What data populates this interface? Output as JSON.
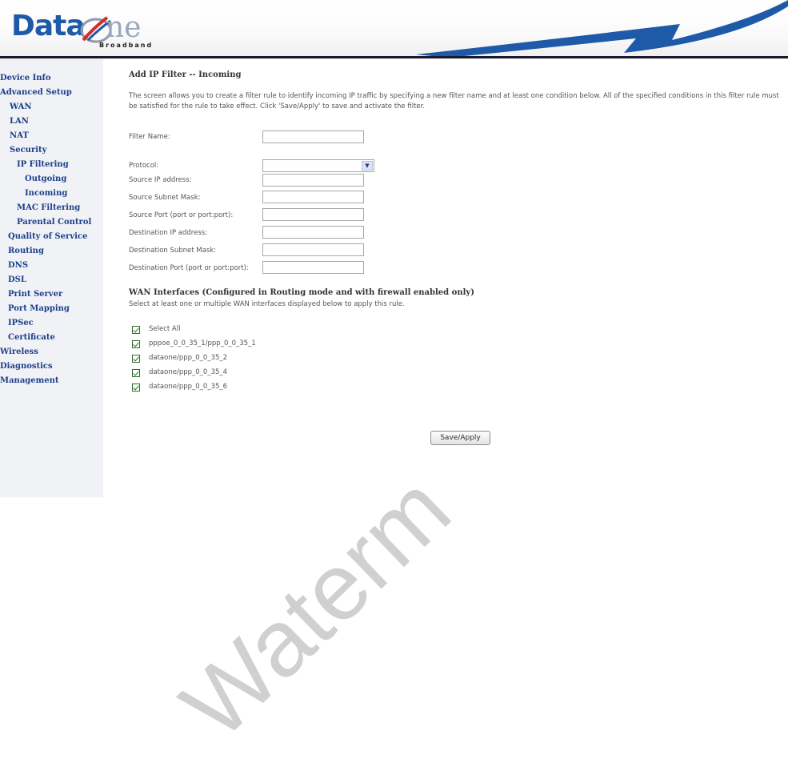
{
  "logo": {
    "brand_first": "Data",
    "brand_second": "ne",
    "tagline": "Broadband"
  },
  "nav": {
    "device_info": "Device Info",
    "advanced_setup": "Advanced Setup",
    "wan": "WAN",
    "lan": "LAN",
    "nat": "NAT",
    "security": "Security",
    "ip_filtering": "IP Filtering",
    "outgoing": "Outgoing",
    "incoming": "Incoming",
    "mac_filtering": "MAC Filtering",
    "parental_control": "Parental Control",
    "qos": "Quality of Service",
    "routing": "Routing",
    "dns": "DNS",
    "dsl": "DSL",
    "print_server": "Print Server",
    "port_mapping": "Port Mapping",
    "ipsec": "IPSec",
    "certificate": "Certificate",
    "wireless": "Wireless",
    "diagnostics": "Diagnostics",
    "management": "Management"
  },
  "page": {
    "title": "Add IP Filter -- Incoming",
    "description": "The screen allows you to create a filter rule to identify incoming IP traffic by specifying a new filter name and at least one condition below. All of the specified conditions in this filter rule must be satisfied for the rule to take effect. Click 'Save/Apply' to save and activate the filter."
  },
  "form": {
    "filter_name_label": "Filter Name:",
    "filter_name_value": "",
    "protocol_label": "Protocol:",
    "protocol_value": "",
    "src_ip_label": "Source IP address:",
    "src_mask_label": "Source Subnet Mask:",
    "src_port_label": "Source Port (port or port:port):",
    "dst_ip_label": "Destination IP address:",
    "dst_mask_label": "Destination Subnet Mask:",
    "dst_port_label": "Destination Port (port or port:port):"
  },
  "wan": {
    "heading": "WAN Interfaces (Configured in Routing mode and with firewall enabled only)",
    "subtext": "Select at least one or multiple WAN interfaces displayed below to apply this rule.",
    "options": [
      {
        "label": "Select All",
        "checked": true
      },
      {
        "label": "pppoe_0_0_35_1/ppp_0_0_35_1",
        "checked": true
      },
      {
        "label": "dataone/ppp_0_0_35_2",
        "checked": true
      },
      {
        "label": "dataone/ppp_0_0_35_4",
        "checked": true
      },
      {
        "label": "dataone/ppp_0_0_35_6",
        "checked": true
      }
    ]
  },
  "save_button": "Save/Apply",
  "watermark": "Waterm",
  "colors": {
    "nav_link": "#1a3f8c",
    "logo_blue": "#1f5aa8",
    "sidebar_bg": "#f1f2f5",
    "check_green": "#1f7a1f"
  }
}
